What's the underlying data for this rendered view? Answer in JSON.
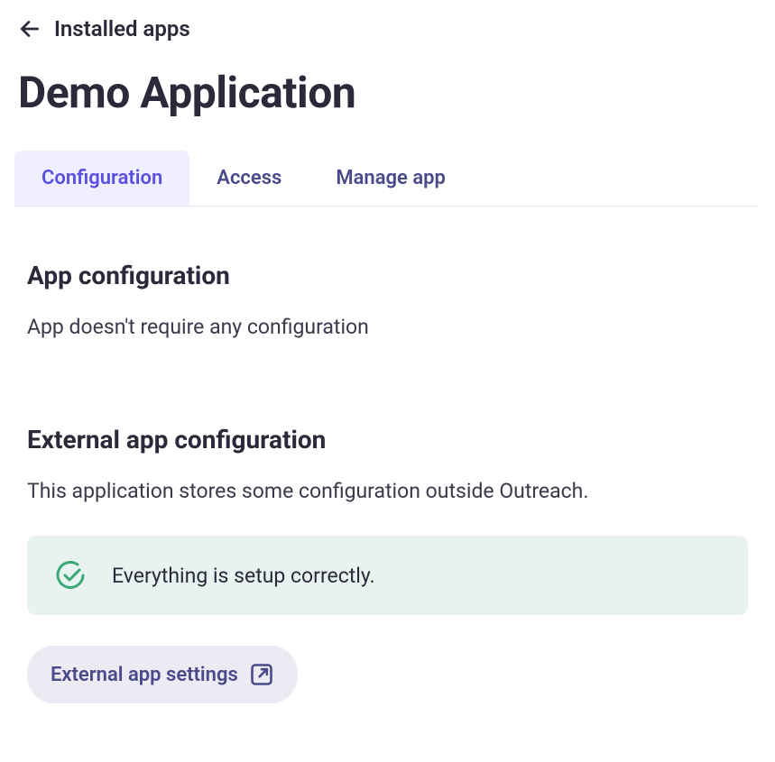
{
  "breadcrumb": {
    "back_label": "Installed apps"
  },
  "page": {
    "title": "Demo Application"
  },
  "tabs": [
    {
      "label": "Configuration",
      "active": true
    },
    {
      "label": "Access",
      "active": false
    },
    {
      "label": "Manage app",
      "active": false
    }
  ],
  "sections": {
    "app_config": {
      "title": "App configuration",
      "text": "App doesn't require any configuration"
    },
    "external_config": {
      "title": "External app configuration",
      "text": "This application stores some configuration outside Outreach.",
      "status": "Everything is setup correctly.",
      "button_label": "External app settings"
    }
  },
  "colors": {
    "accent": "#5a50e0",
    "tab_inactive": "#4a4a8a",
    "success": "#3ba876",
    "success_bg": "#e8f3ef"
  }
}
